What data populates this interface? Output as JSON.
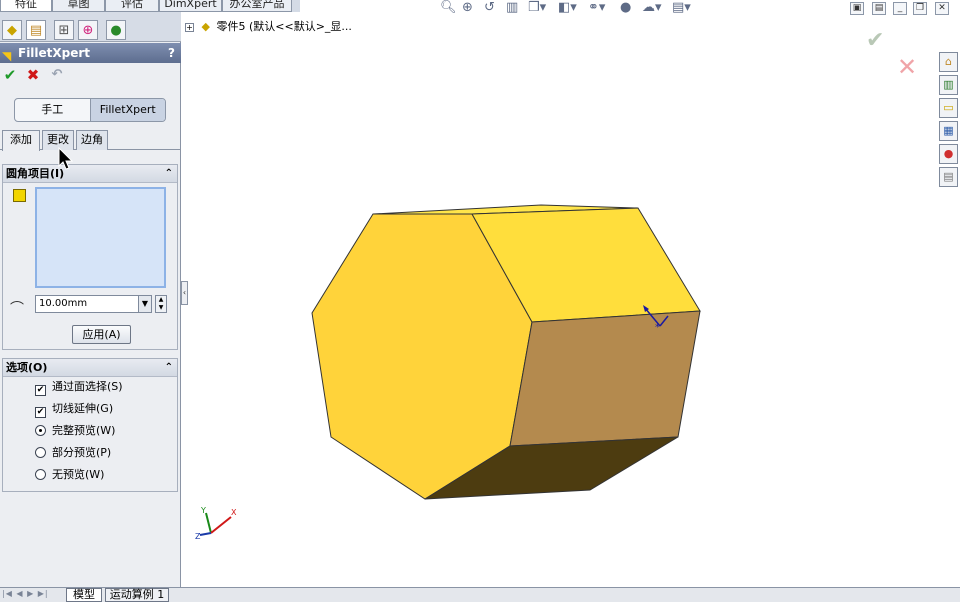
{
  "command_tabs": [
    "特征",
    "草图",
    "评估",
    "DimXpert",
    "办公室产品"
  ],
  "property_manager": {
    "title": "FilletXpert",
    "help": "?",
    "ok_icon": "check-icon",
    "cancel_icon": "x-icon",
    "undo_icon": "undo-icon",
    "mode_buttons": [
      "手工",
      "FilletXpert"
    ],
    "active_mode": "FilletXpert",
    "subtabs": [
      "添加",
      "更改",
      "边角"
    ],
    "active_subtab": "添加",
    "items_group": {
      "title": "圆角项目(I)",
      "radius_value": "10.00mm",
      "apply_label": "应用(A)"
    },
    "options_group": {
      "title": "选项(O)",
      "checkboxes": [
        {
          "label": "通过面选择(S)",
          "checked": true
        },
        {
          "label": "切线延伸(G)",
          "checked": true
        }
      ],
      "radios": [
        {
          "label": "完整预览(W)",
          "selected": true
        },
        {
          "label": "部分预览(P)",
          "selected": false
        },
        {
          "label": "无预览(W)",
          "selected": false
        }
      ]
    }
  },
  "graphics": {
    "tree_text": "零件5   (默认<<默认>_显...",
    "part_name": "零件5",
    "config_text": "(默认<<默认>_显..."
  },
  "bottom_tabs": [
    "模型",
    "运动算例 1"
  ],
  "colors": {
    "face_top": "#ffe24a",
    "face_front": "#ffd33a",
    "face_right": "#b48a4e",
    "face_bottom": "#4d3c10",
    "accent_green": "#1f9a2a",
    "accent_red": "#d01818"
  }
}
